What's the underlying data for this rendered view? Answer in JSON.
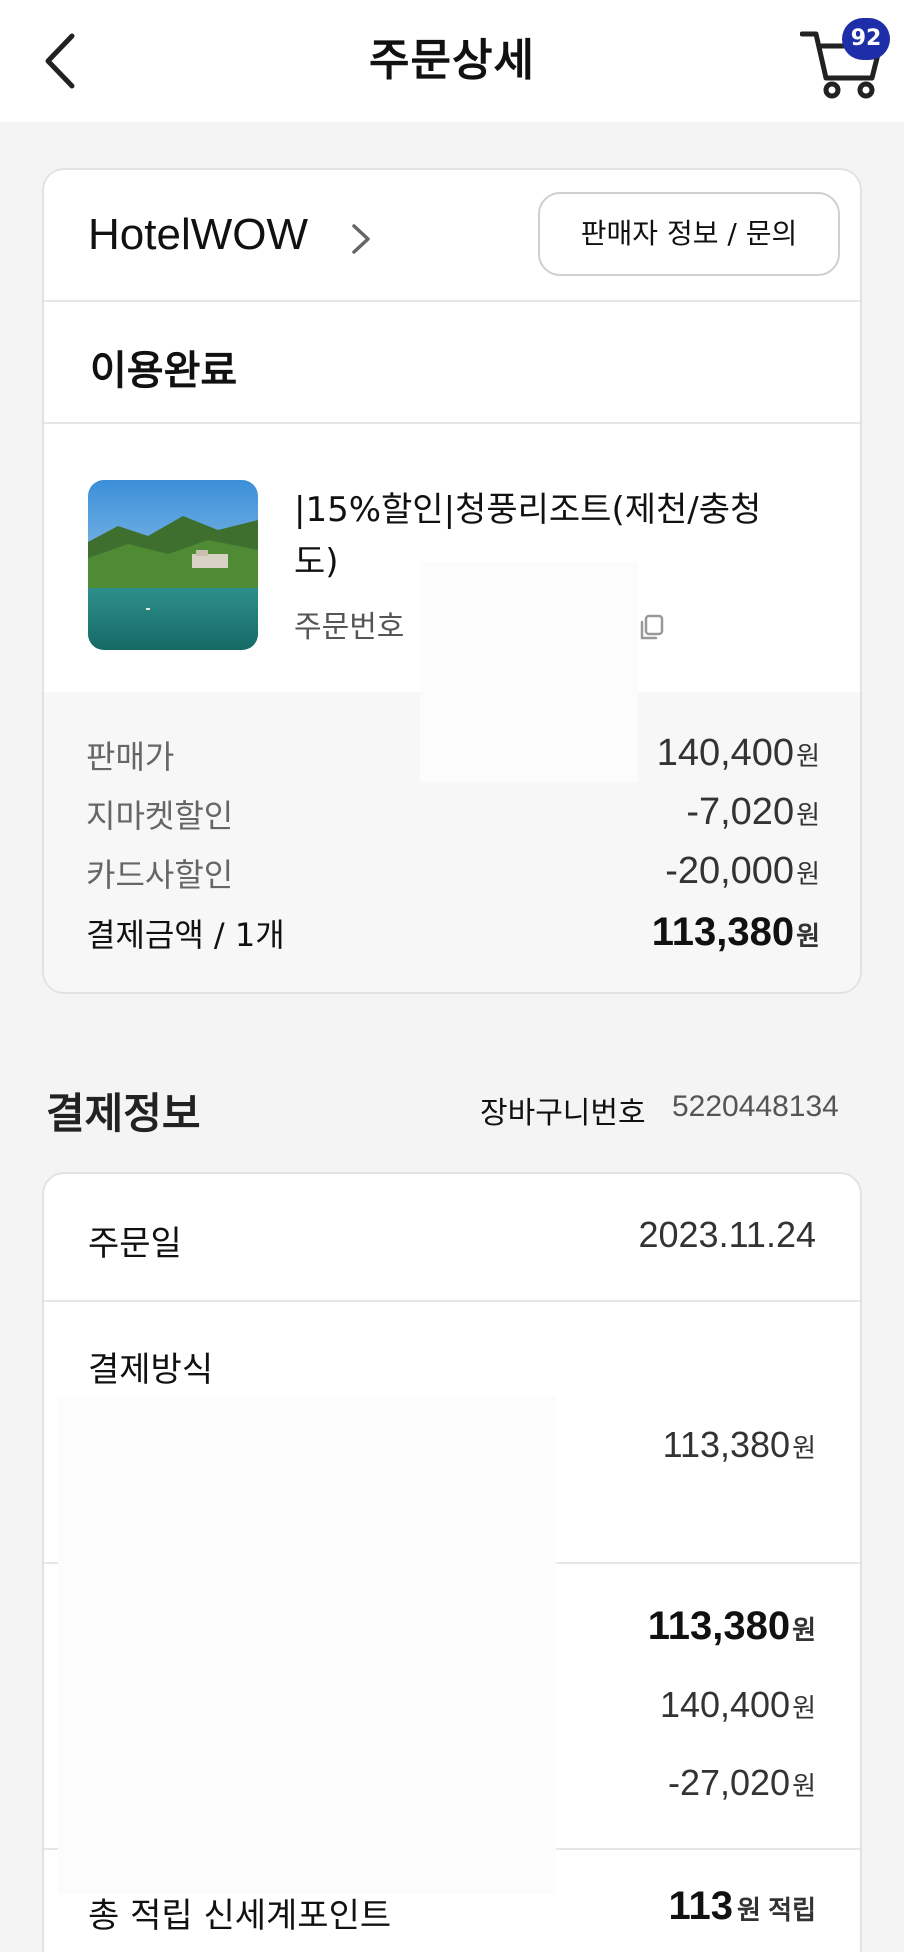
{
  "header": {
    "title": "주문상세",
    "cart_badge": "92"
  },
  "order": {
    "seller_name": "HotelWOW",
    "seller_button": "판매자 정보 / 문의",
    "status": "이용완료",
    "product_name": "|15%할인|청풍리조트(제천/충청도)",
    "order_no_label": "주문번호",
    "prices": [
      {
        "label": "판매가",
        "value": "140,400",
        "unit": "원"
      },
      {
        "label": "지마켓할인",
        "value": "-7,020",
        "unit": "원"
      },
      {
        "label": "카드사할인",
        "value": "-20,000",
        "unit": "원"
      },
      {
        "label": "결제금액 / 1개",
        "value": "113,380",
        "unit": "원"
      }
    ]
  },
  "payment": {
    "title": "결제정보",
    "cart_no_label": "장바구니번호",
    "cart_no_value": "5220448134",
    "order_date_label": "주문일",
    "order_date_value": "2023.11.24",
    "method_label": "결제방식",
    "method_amount": "113,380",
    "summary_total": "113,380",
    "summary_price": "140,400",
    "summary_discount": "-27,020",
    "unit": "원",
    "points_label": "총 적립 신세계포인트",
    "points_value": "113",
    "points_suffix": "원 적립"
  },
  "colors": {
    "badge": "#1d2ea8",
    "background": "#f4f4f4"
  },
  "icons": [
    "back-icon",
    "cart-icon",
    "chevron-right-icon",
    "copy-icon"
  ]
}
